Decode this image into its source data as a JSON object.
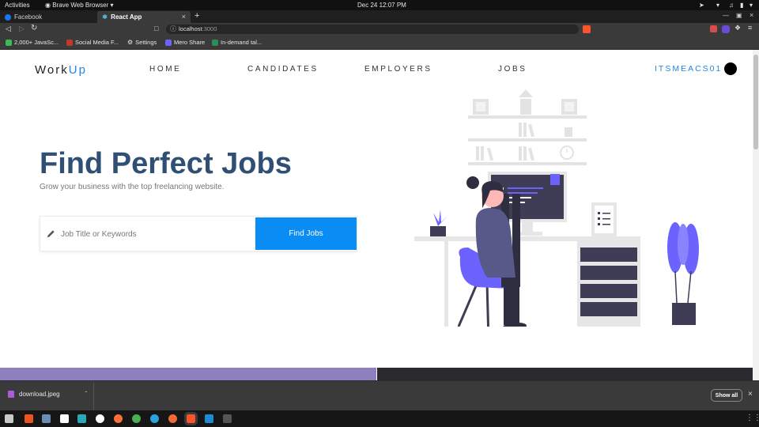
{
  "system_bar": {
    "activities": "Activities",
    "app_menu": "Brave Web Browser",
    "clock": "Dec 24  12:07 PM"
  },
  "tabs": [
    {
      "label": "Facebook",
      "active": false
    },
    {
      "label": "React App",
      "active": true
    }
  ],
  "address_bar": {
    "url_host": "localhost",
    "url_port": ":3000"
  },
  "bookmarks": [
    {
      "label": "2,000+ JavaSc..."
    },
    {
      "label": "Social Media F..."
    },
    {
      "label": "Settings"
    },
    {
      "label": "Mero Share"
    },
    {
      "label": "In-demand tal..."
    }
  ],
  "navbar": {
    "logo_main": "Work",
    "logo_accent": "Up",
    "links": [
      "HOME",
      "CANDIDATES",
      "EMPLOYERS",
      "JOBS"
    ],
    "username": "ITSMEACS01"
  },
  "hero": {
    "title": "Find Perfect Jobs",
    "subtitle": "Grow your business with the top freelancing website.",
    "search_placeholder": "Job Title or Keywords",
    "search_button": "Find Jobs"
  },
  "downloads": {
    "file_name": "download.jpeg",
    "show_all": "Show all"
  },
  "colors": {
    "brand_blue": "#1e88e5",
    "button_blue": "#0a8cf5",
    "title_navy": "#2f4f74",
    "illustration_purple": "#6c63ff"
  }
}
